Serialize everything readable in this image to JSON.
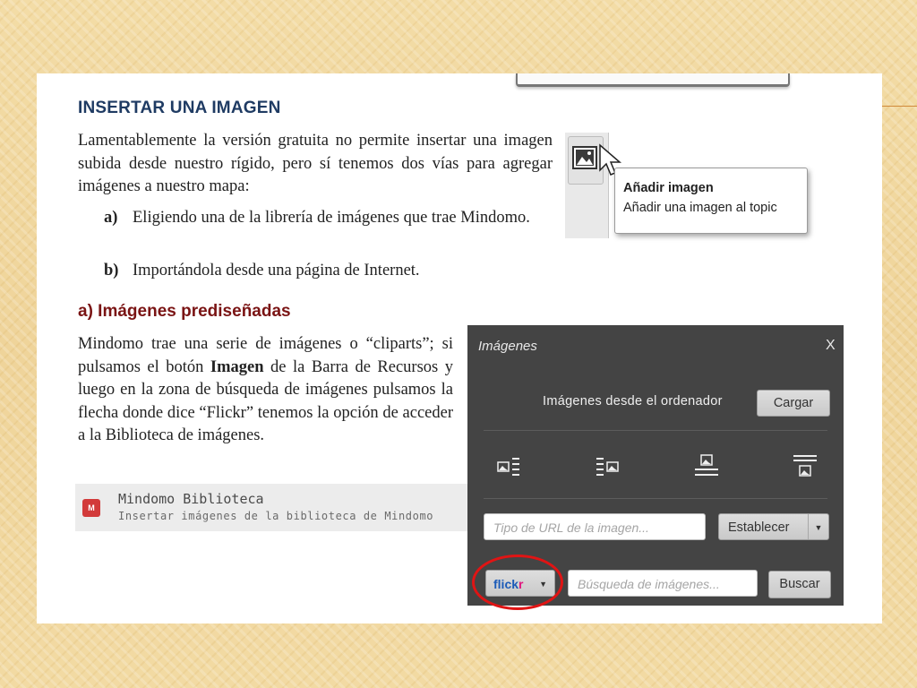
{
  "page": {
    "heading_main": "INSERTAR UNA IMAGEN",
    "intro": "Lamentablemente la versión gratuita no permite insertar una imagen subida desde nuestro rígido, pero sí tenemos dos vías para agregar imágenes a nuestro mapa:",
    "list": [
      {
        "marker": "a)",
        "text": "Eligiendo una de la librería de imágenes que trae Mindomo."
      },
      {
        "marker": "b)",
        "text": "Importándola desde una página de Internet."
      }
    ],
    "heading_sub": "a) Imágenes prediseñadas",
    "para2_before": "Mindomo trae una serie de imágenes o “cliparts”; si pulsamos el botón ",
    "para2_bold": "Imagen",
    "para2_after": " de la Barra de Recursos y luego en la zona de búsqueda de imágenes pulsamos la flecha donde dice “Flickr” tenemos la opción de acceder a la Biblioteca de imágenes."
  },
  "tooltip": {
    "title": "Añadir imagen",
    "description": "Añadir una imagen al topic"
  },
  "biblioteca": {
    "icon_text": "M",
    "title": "Mindomo Biblioteca",
    "subtitle": "Insertar imágenes de la biblioteca de Mindomo"
  },
  "dialog": {
    "title": "Imágenes",
    "close": "X",
    "upload_label": "Imágenes desde el ordenador",
    "upload_button": "Cargar",
    "layout_icons": [
      "image-left-icon",
      "image-right-icon",
      "image-top-icon",
      "image-bottom-icon"
    ],
    "url_placeholder": "Tipo de URL de la imagen...",
    "set_button": "Establecer",
    "source_select": {
      "part1": "flick",
      "part2": "r"
    },
    "search_placeholder": "Búsqueda de imágenes...",
    "search_button": "Buscar"
  },
  "colors": {
    "heading_blue": "#1f3b63",
    "heading_red": "#7a1414",
    "dialog_bg": "#444444",
    "highlight_ring": "#e01414"
  }
}
